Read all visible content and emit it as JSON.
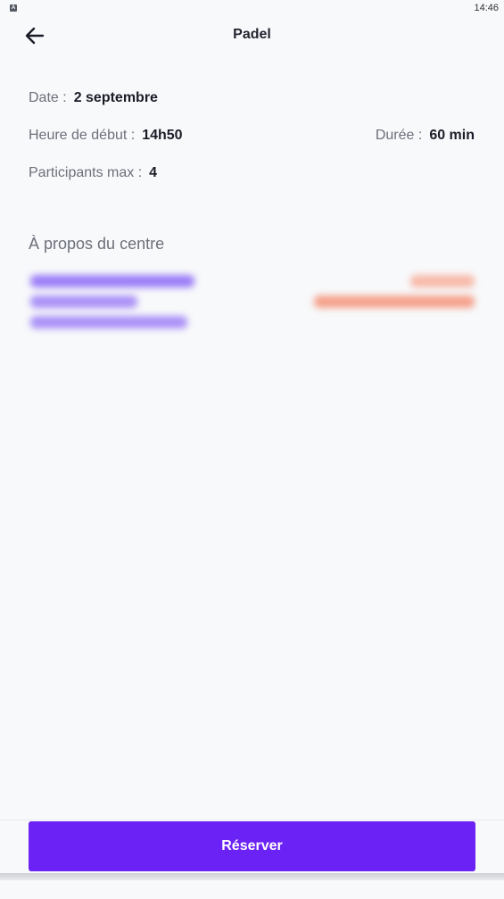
{
  "status_bar": {
    "notif_icon_letter": "A",
    "time": "14:46"
  },
  "header": {
    "title": "Padel",
    "back_icon": "arrow-left-icon"
  },
  "details": {
    "date_label": "Date :",
    "date_value": "2 septembre",
    "start_label": "Heure de début :",
    "start_value": "14h50",
    "duration_label": "Durée :",
    "duration_value": "60 min",
    "participants_label": "Participants max :",
    "participants_value": "4"
  },
  "about": {
    "title": "À propos du centre"
  },
  "footer": {
    "reserve_label": "Réserver"
  },
  "colors": {
    "accent": "#6b22f5",
    "background": "#f8f9fb",
    "blurred_name_color": "#8c6cf5",
    "blurred_contact_color": "#f5a08a"
  }
}
